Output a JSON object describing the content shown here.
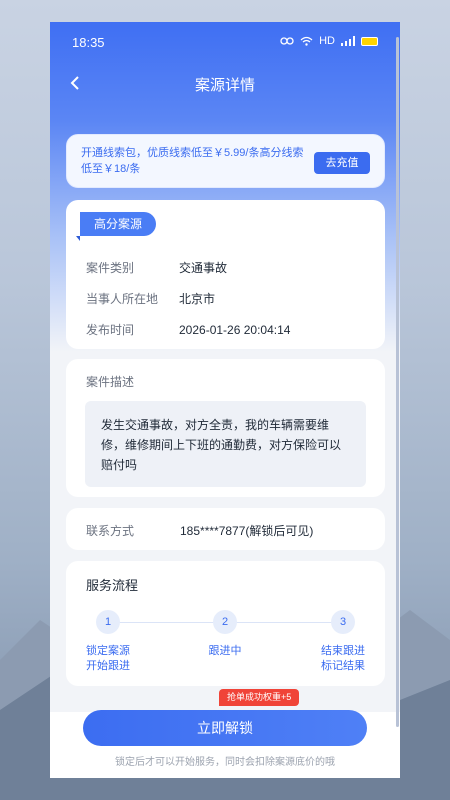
{
  "status": {
    "time": "18:35",
    "network": "HD"
  },
  "nav": {
    "title": "案源详情"
  },
  "promo": {
    "text": "开通线索包，优质线索低至￥5.99/条高分线索低至￥18/条",
    "button": "去充值"
  },
  "info": {
    "tag": "高分案源",
    "rows": [
      {
        "label": "案件类别",
        "value": "交通事故"
      },
      {
        "label": "当事人所在地",
        "value": "北京市"
      },
      {
        "label": "发布时间",
        "value": "2026-01-26 20:04:14"
      }
    ]
  },
  "description": {
    "title": "案件描述",
    "text": "发生交通事故，对方全责，我的车辆需要维修，维修期间上下班的通勤费，对方保险可以赔付吗"
  },
  "contact": {
    "label": "联系方式",
    "value": "185****7877(解锁后可见)"
  },
  "flow": {
    "title": "服务流程",
    "steps": [
      {
        "num": "1",
        "line1": "锁定案源",
        "line2": "开始跟进"
      },
      {
        "num": "2",
        "line1": "跟进中",
        "line2": ""
      },
      {
        "num": "3",
        "line1": "结束跟进",
        "line2": "标记结果"
      }
    ]
  },
  "bottom": {
    "badge": "抢单成功权重+5",
    "button": "立即解锁",
    "hint": "锁定后才可以开始服务，同时会扣除案源底价的哦"
  },
  "colors": {
    "primary": "#3b6cf0",
    "badge": "#f04438"
  }
}
